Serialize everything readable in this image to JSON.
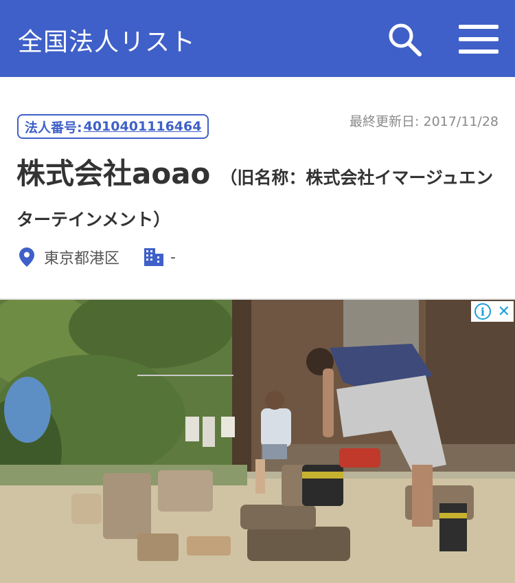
{
  "header": {
    "logo": "全国法人リスト",
    "background_color": "#3f60c8",
    "search_icon": "search-icon",
    "menu_icon": "hamburger-menu-icon"
  },
  "company": {
    "corp_number_label": "法人番号:",
    "corp_number": "4010401116464",
    "updated_label": "最終更新日: 2017/11/28",
    "name": "株式会社aoao",
    "former_name": "（旧名称：株式会社イマージュエンターテインメント）",
    "location": "東京都港区",
    "industry": "-"
  },
  "ad": {
    "adchoices_info": "i",
    "adchoices_close": "✕"
  },
  "colors": {
    "accent": "#3f60c8",
    "text": "#333333",
    "muted": "#8a8a8a"
  }
}
